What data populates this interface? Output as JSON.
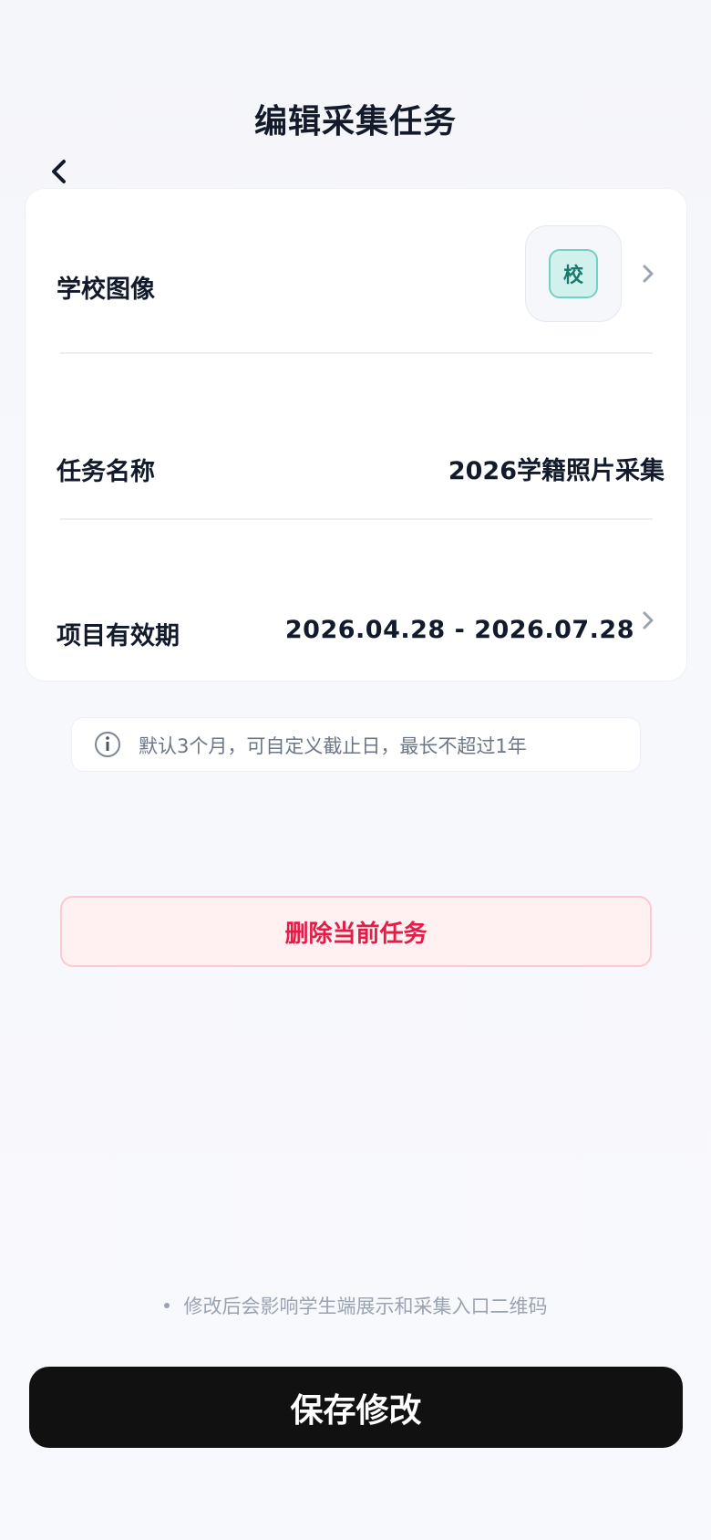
{
  "header": {
    "title": "编辑采集任务",
    "back_icon": "chevron-left-icon"
  },
  "form": {
    "school_image": {
      "label": "学校图像",
      "badge_text": "校",
      "chevron_icon": "chevron-right-icon"
    },
    "task_name": {
      "label": "任务名称",
      "value": "2026学籍照片采集"
    },
    "validity": {
      "label": "项目有效期",
      "value": "2026.04.28 - 2026.07.28",
      "chevron_icon": "chevron-right-icon"
    }
  },
  "hint": {
    "icon": "info-icon",
    "text": "默认3个月，可自定义截止日，最长不超过1年"
  },
  "actions": {
    "delete_label": "删除当前任务",
    "save_label": "保存修改"
  },
  "footnote": {
    "text": "修改后会影响学生端展示和采集入口二维码"
  },
  "colors": {
    "primary_text": "#121a2b",
    "danger": "#e11d48",
    "danger_bg": "#fff1f2",
    "save_bg": "#111111",
    "badge_bg": "#d2f1ec",
    "badge_text": "#177a6c"
  }
}
